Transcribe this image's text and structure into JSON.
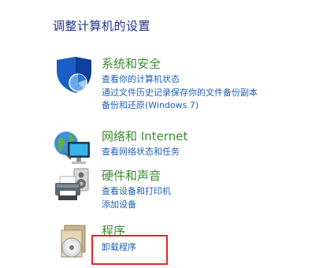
{
  "page_title": "调整计算机的设置",
  "categories": [
    {
      "icon": "shield-icon",
      "title": "系统和安全",
      "links": [
        "查看你的计算机状态",
        "通过文件历史记录保存你的文件备份副本",
        "备份和还原(Windows 7)"
      ]
    },
    {
      "icon": "network-globe-icon",
      "title": "网络和 Internet",
      "links": [
        "查看网络状态和任务"
      ]
    },
    {
      "icon": "printer-speaker-icon",
      "title": "硬件和声音",
      "links": [
        "查看设备和打印机",
        "添加设备"
      ]
    },
    {
      "icon": "programs-disc-icon",
      "title": "程序",
      "links": [
        "卸载程序"
      ]
    }
  ],
  "colors": {
    "title": "#1e3287",
    "category_title": "#3a8a2f",
    "link": "#1f5fb5",
    "highlight": "#e5242b"
  }
}
